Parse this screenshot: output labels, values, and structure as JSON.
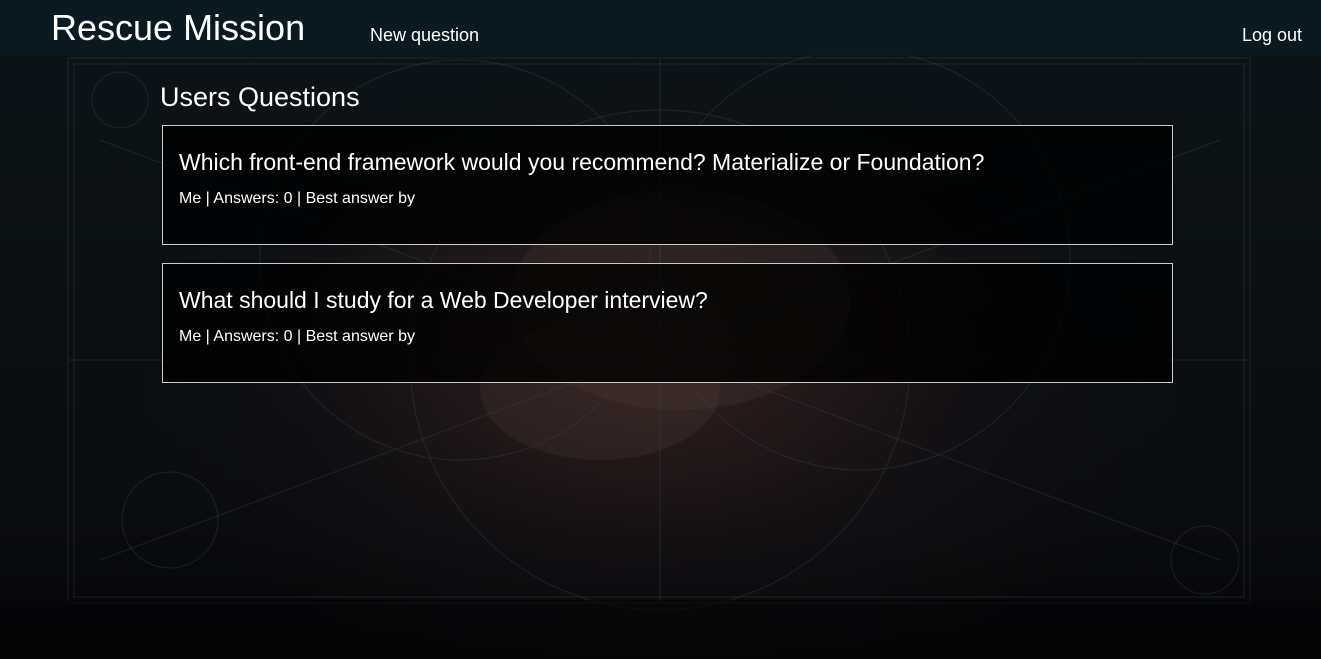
{
  "navbar": {
    "brand": "Rescue Mission",
    "new_question": "New question",
    "log_out": "Log out"
  },
  "main": {
    "title": "Users Questions",
    "questions": [
      {
        "title": "Which front-end framework would you recommend? Materialize or Foundation?",
        "author": "Me",
        "sep1": " | ",
        "answers_label": "Answers: 0",
        "sep2": " | ",
        "best_answer_label": "Best answer by"
      },
      {
        "title": "What should I study for a Web Developer interview?",
        "author": "Me",
        "sep1": " | ",
        "answers_label": "Answers: 0",
        "sep2": " | ",
        "best_answer_label": "Best answer by"
      }
    ]
  },
  "colors": {
    "navbar_bg": "#0a1c22",
    "card_border": "#c9c9c9",
    "text": "#ffffff"
  }
}
